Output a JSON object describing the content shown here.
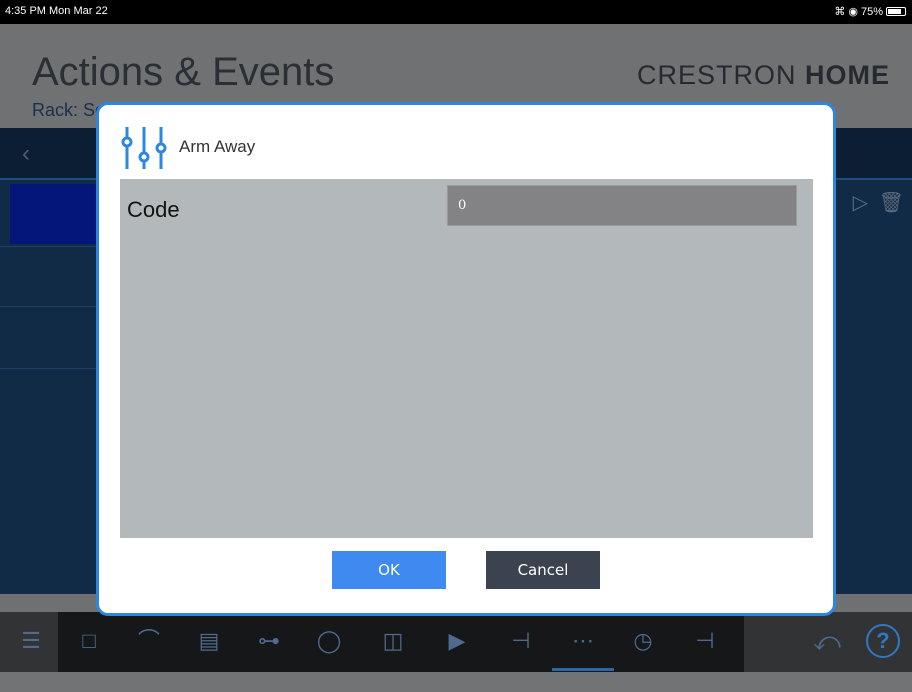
{
  "status_bar": {
    "time": "4:35 PM  Mon Mar 22",
    "battery": "75%"
  },
  "background": {
    "title": "Actions & Events",
    "subtitle": "Rack: Security PRO",
    "brand_light": "CRESTRON ",
    "brand_bold": "HOME"
  },
  "modal": {
    "title": "Arm Away",
    "icon": "sliders-icon",
    "field": {
      "label": "Code",
      "value": "0"
    },
    "ok_label": "OK",
    "cancel_label": "Cancel"
  },
  "colors": {
    "accent": "#2d86e0",
    "ok_button": "#3f8af0",
    "cancel_button": "#3b4350",
    "body_bg": "#b3b8bb"
  },
  "toolbar_icons": [
    "menu-icon",
    "add-device-icon",
    "security-icon",
    "shades-icon",
    "scenes-icon",
    "lights-icon",
    "door-icon",
    "media-icon",
    "thermostat-icon",
    "keypad-icon",
    "clock-icon",
    "temperature-icon",
    "back-arrow-icon",
    "help-icon"
  ]
}
